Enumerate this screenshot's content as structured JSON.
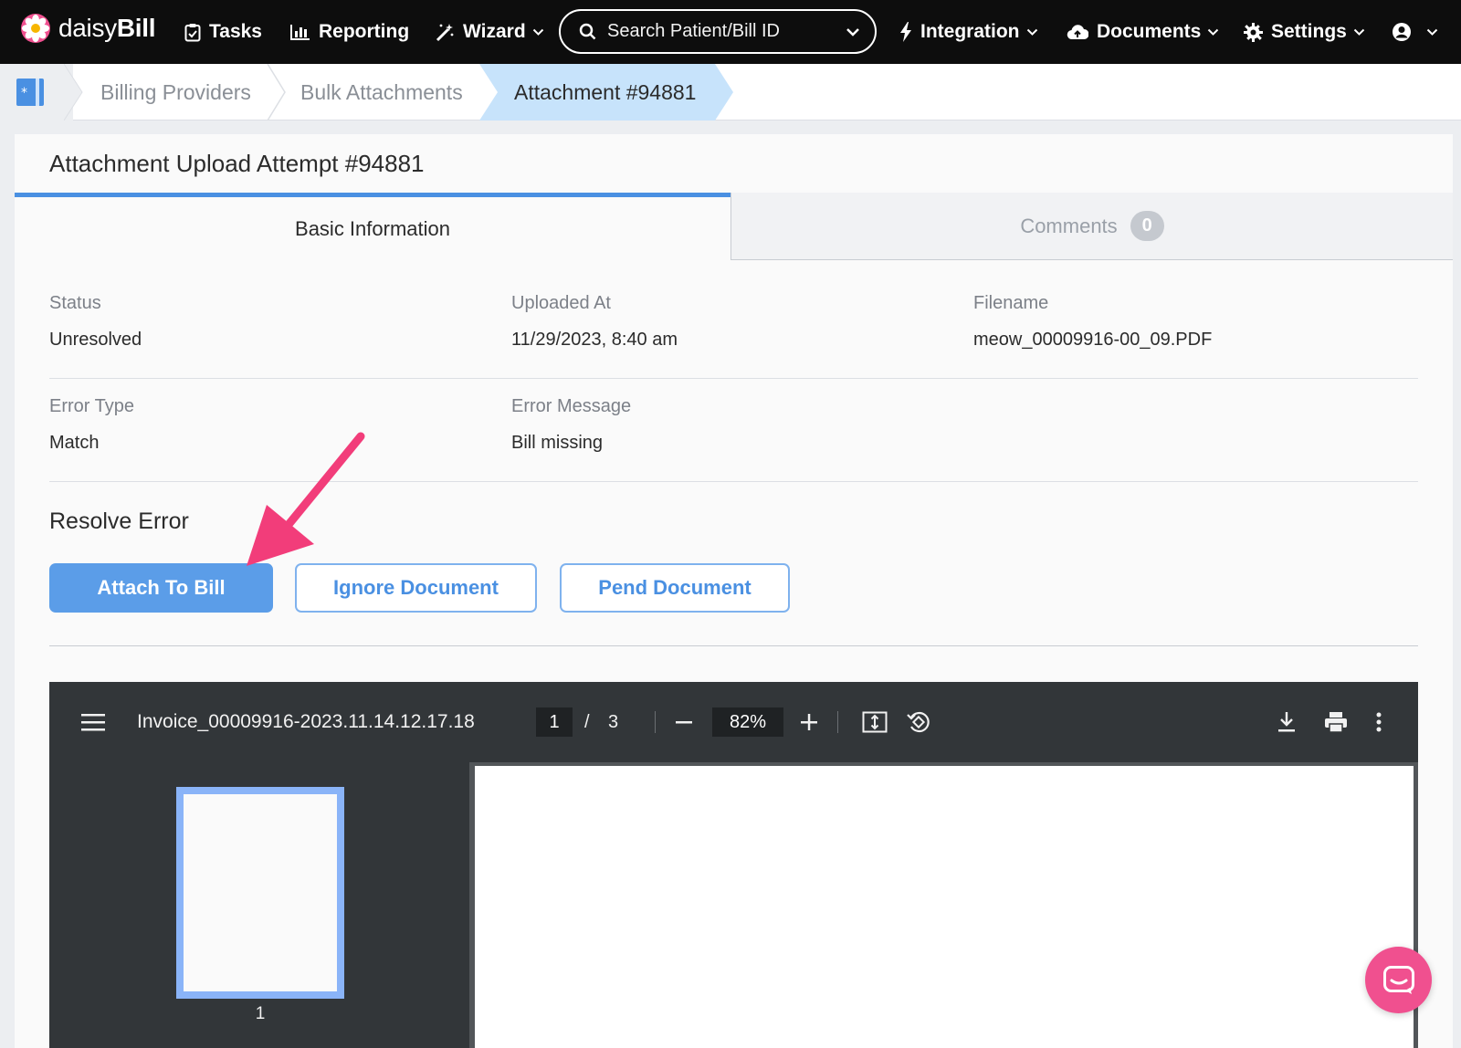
{
  "app": {
    "brand_light": "daisy",
    "brand_bold": "Bill",
    "brand_color": "#f0508f"
  },
  "nav": {
    "tasks": "Tasks",
    "reporting": "Reporting",
    "wizard": "Wizard",
    "search_placeholder": "Search Patient/Bill ID",
    "integration": "Integration",
    "documents": "Documents",
    "settings": "Settings"
  },
  "breadcrumb": {
    "items": [
      "Billing Providers",
      "Bulk Attachments",
      "Attachment #94881"
    ],
    "active_color": "#c7e3fb"
  },
  "page": {
    "title": "Attachment Upload Attempt #94881",
    "tabs": [
      {
        "label": "Basic Information",
        "active": true
      },
      {
        "label": "Comments",
        "count": "0",
        "active": false
      }
    ]
  },
  "details": {
    "status_label": "Status",
    "status_value": "Unresolved",
    "uploaded_label": "Uploaded At",
    "uploaded_value": "11/29/2023, 8:40 am",
    "filename_label": "Filename",
    "filename_value": "meow_00009916-00_09.PDF",
    "error_type_label": "Error Type",
    "error_type_value": "Match",
    "error_message_label": "Error Message",
    "error_message_value": "Bill missing"
  },
  "resolve": {
    "title": "Resolve Error",
    "attach_label": "Attach To Bill",
    "ignore_label": "Ignore Document",
    "pend_label": "Pend Document",
    "primary_color": "#5b9de8"
  },
  "pdf_viewer": {
    "filename": "Invoice_00009916-2023.11.14.12.17.18",
    "current_page": "1",
    "page_separator": "/",
    "total_pages": "3",
    "zoom": "82%",
    "thumbnail_label": "1"
  },
  "annotation": {
    "arrow_color": "#f23d7a"
  }
}
